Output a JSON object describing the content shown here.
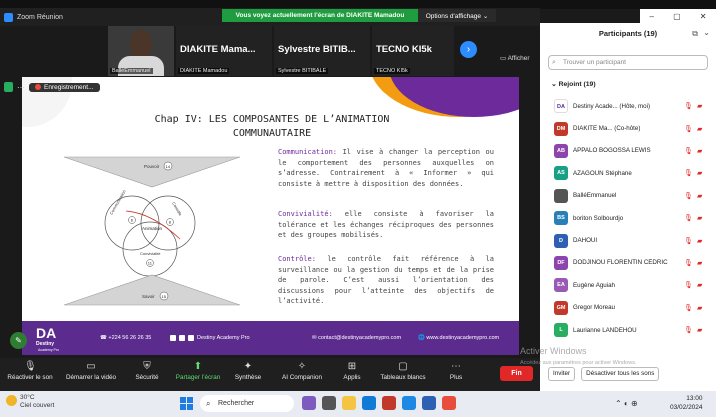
{
  "window": {
    "title": "Zoom Réunion"
  },
  "banner": {
    "text": "Vous voyez actuellement l'écran de DIAKITE Mamadou",
    "view_options": "Options d'affichage ⌄"
  },
  "gallery": {
    "tiles": [
      {
        "big": "",
        "name": "BalléEmmanuel"
      },
      {
        "big": "DIAKITE Mama...",
        "name": "DIAKITE Mamadou"
      },
      {
        "big": "Sylvestre BITIB...",
        "name": "Sylvestre BITIBALE"
      },
      {
        "big": "TECNO KI5k",
        "name": "TECNO KI5k"
      }
    ],
    "hide_label": "Afficher"
  },
  "recording": {
    "label": "Enregistrement..."
  },
  "slide": {
    "title_line1": "Chap IV: LES COMPOSANTES DE L’ANIMATION",
    "title_line2": "COMMUNAUTAIRE",
    "diagram": {
      "top_label": "Pouvoir",
      "top_num": "14",
      "circle_top": "Communication",
      "circle_right": "Contrôle",
      "circle_bottom": "Convivialité",
      "center": "Animation",
      "num_left": "6",
      "num_right": "8",
      "num_bottom": "11",
      "bottom_label": "Savoir",
      "bottom_num": "15"
    },
    "communication": {
      "term": "Communication:",
      "text": " Il vise à changer la perception ou le comportement des personnes auxquelles on s’adresse. Contrairement à « Informer » qui consiste à mettre à disposition des données."
    },
    "convivialite": {
      "term": "Convivialité:",
      "text": " elle consiste à favoriser la tolérance et les échanges réciproques des personnes et des groupes mobilisés."
    },
    "controle": {
      "term": "Contrôle:",
      "text": " le contrôle fait référence à la surveillance ou la gestion du temps et de la prise de parole. C’est aussi l’orientation des discussions pour l’atteinte des objectifs de l’activité."
    },
    "footer": {
      "logo": "DA",
      "logo_sub": "Destiny",
      "logo_sub2": "Academy Pro",
      "phone": "+224 56 26 26 35",
      "social": "Destiny Academy Pro",
      "email": "contact@destinyacademypro.com",
      "web": "www.destinyacademypro.com"
    }
  },
  "toolbar": {
    "items": [
      {
        "icon": "mic-icon",
        "glyph": "🎙",
        "label": "Réactiver le son"
      },
      {
        "icon": "video-icon",
        "glyph": "▭",
        "label": "Démarrer la vidéo"
      },
      {
        "icon": "security-icon",
        "glyph": "⛨",
        "label": "Sécurité"
      },
      {
        "icon": "share-icon",
        "glyph": "⬆",
        "label": "Partager l’écran"
      },
      {
        "icon": "summary-icon",
        "glyph": "✦",
        "label": "Synthèse"
      },
      {
        "icon": "ai-icon",
        "glyph": "✧",
        "label": "AI Companion"
      },
      {
        "icon": "apps-icon",
        "glyph": "⊞",
        "label": "Applis"
      },
      {
        "icon": "whiteboard-icon",
        "glyph": "▢",
        "label": "Tableaux blancs"
      },
      {
        "icon": "more-icon",
        "glyph": "⋯",
        "label": "Plus"
      }
    ],
    "end_label": "Fin"
  },
  "participants": {
    "title": "Participants (19)",
    "search_placeholder": "Trouver un participant",
    "joined_label": "Rejoint (19)",
    "list": [
      {
        "initials": "DA",
        "color": "#ffffff",
        "text_color": "#5b2c8e",
        "name": "Destiny Acade... (Hôte, moi)"
      },
      {
        "initials": "DM",
        "color": "#c0392b",
        "name": "DIAKITE Ma... (Co-hôte)"
      },
      {
        "initials": "AB",
        "color": "#8e44ad",
        "name": "APPALO BOGOSSA LEWIS"
      },
      {
        "initials": "AS",
        "color": "#16a085",
        "name": "AZAGOUN Stéphane"
      },
      {
        "initials": "",
        "color": "#555555",
        "name": "BalléEmmanuel"
      },
      {
        "initials": "BS",
        "color": "#2980b9",
        "name": "boriton Solbourdjo"
      },
      {
        "initials": "D",
        "color": "#2d5fb3",
        "name": "DAHOUI"
      },
      {
        "initials": "DF",
        "color": "#8e44ad",
        "name": "DODJINOU FLORENTIN CÉDRIC"
      },
      {
        "initials": "EA",
        "color": "#9b59b6",
        "name": "Eugène Aguiah"
      },
      {
        "initials": "GM",
        "color": "#c0392b",
        "name": "Gregor Moreau"
      },
      {
        "initials": "L",
        "color": "#27ae60",
        "name": "Laurianne LANDEHOU"
      }
    ],
    "invite": "Inviter",
    "mute_all": "Désactiver tous les sons"
  },
  "watermark": {
    "line1": "Activer Windows",
    "line2": "Accédez aux paramètres pour activer Windows."
  },
  "taskbar": {
    "temp": "30°C",
    "weather": "Ciel couvert",
    "search": "Rechercher",
    "time": "13:00",
    "date": "03/02/2024"
  }
}
